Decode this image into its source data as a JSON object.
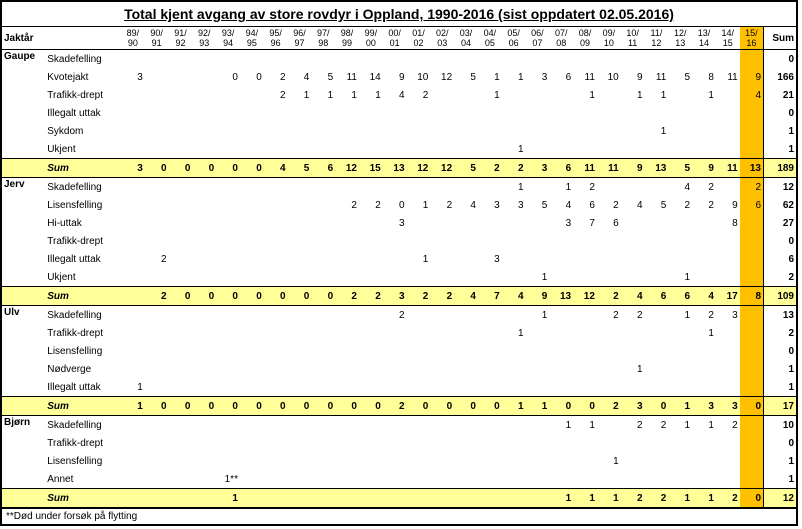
{
  "title": "Total kjent avgang av store rovdyr i Oppland, 1990-2016 (sist oppdatert 02.05.2016)",
  "axis_label": "Jaktår",
  "footnote": "**Død under forsøk på flytting",
  "sum_label": "Sum",
  "years": [
    "89/ 90",
    "90/ 91",
    "91/ 92",
    "92/ 93",
    "93/ 94",
    "94/ 95",
    "95/ 96",
    "96/ 97",
    "97/ 98",
    "98/ 99",
    "99/ 00",
    "00/ 01",
    "01/ 02",
    "02/ 03",
    "03/ 04",
    "04/ 05",
    "05/ 06",
    "06/ 07",
    "07/ 08",
    "08/ 09",
    "09/ 10",
    "10/ 11",
    "11/ 12",
    "12/ 13",
    "13/ 14",
    "14/ 15",
    "15/ 16"
  ],
  "species": [
    {
      "name": "Gaupe",
      "rows": [
        {
          "label": "Skadefelling",
          "vals": [
            "",
            "",
            "",
            "",
            "",
            "",
            "",
            "",
            "",
            "",
            "",
            "",
            "",
            "",
            "",
            "",
            "",
            "",
            "",
            "",
            "",
            "",
            "",
            "",
            "",
            "",
            ""
          ],
          "sum": "0"
        },
        {
          "label": "Kvotejakt",
          "vals": [
            "3",
            "",
            "",
            "",
            "0",
            "0",
            "2",
            "4",
            "5",
            "11",
            "14",
            "9",
            "10",
            "12",
            "5",
            "1",
            "1",
            "3",
            "6",
            "11",
            "10",
            "9",
            "11",
            "5",
            "8",
            "11",
            "9"
          ],
          "sum": "166"
        },
        {
          "label": "Trafikk-drept",
          "vals": [
            "",
            "",
            "",
            "",
            "",
            "",
            "2",
            "1",
            "1",
            "1",
            "1",
            "4",
            "2",
            "",
            "",
            "1",
            "",
            "",
            "",
            "1",
            "",
            "1",
            "1",
            "",
            "1",
            "",
            "4"
          ],
          "sum": "21"
        },
        {
          "label": "Illegalt uttak",
          "vals": [
            "",
            "",
            "",
            "",
            "",
            "",
            "",
            "",
            "",
            "",
            "",
            "",
            "",
            "",
            "",
            "",
            "",
            "",
            "",
            "",
            "",
            "",
            "",
            "",
            "",
            "",
            ""
          ],
          "sum": "0"
        },
        {
          "label": "Sykdom",
          "vals": [
            "",
            "",
            "",
            "",
            "",
            "",
            "",
            "",
            "",
            "",
            "",
            "",
            "",
            "",
            "",
            "",
            "",
            "",
            "",
            "",
            "",
            "",
            "1",
            "",
            "",
            "",
            ""
          ],
          "sum": "1"
        },
        {
          "label": "Ukjent",
          "vals": [
            "",
            "",
            "",
            "",
            "",
            "",
            "",
            "",
            "",
            "",
            "",
            "",
            "",
            "",
            "",
            "",
            "1",
            "",
            "",
            "",
            "",
            "",
            "",
            "",
            "",
            "",
            ""
          ],
          "sum": "1"
        }
      ],
      "sum": {
        "vals": [
          "3",
          "0",
          "0",
          "0",
          "0",
          "0",
          "4",
          "5",
          "6",
          "12",
          "15",
          "13",
          "12",
          "12",
          "5",
          "2",
          "2",
          "3",
          "6",
          "11",
          "11",
          "9",
          "13",
          "5",
          "9",
          "11",
          "13"
        ],
        "sum": "189"
      },
      "highlight": "7"
    },
    {
      "name": "Jerv",
      "rows": [
        {
          "label": "Skadefelling",
          "vals": [
            "",
            "",
            "",
            "",
            "",
            "",
            "",
            "",
            "",
            "",
            "",
            "",
            "",
            "",
            "",
            "",
            "1",
            "",
            "1",
            "2",
            "",
            "",
            "",
            "4",
            "2",
            "",
            "2"
          ],
          "sum": "12"
        },
        {
          "label": "Lisensfelling",
          "vals": [
            "",
            "",
            "",
            "",
            "",
            "",
            "",
            "",
            "",
            "2",
            "2",
            "0",
            "1",
            "2",
            "4",
            "3",
            "3",
            "5",
            "4",
            "6",
            "2",
            "4",
            "5",
            "2",
            "2",
            "9",
            "6"
          ],
          "sum": "62"
        },
        {
          "label": "Hi-uttak",
          "vals": [
            "",
            "",
            "",
            "",
            "",
            "",
            "",
            "",
            "",
            "",
            "",
            "3",
            "",
            "",
            "",
            "",
            "",
            "",
            "3",
            "7",
            "6",
            "",
            "",
            "",
            "",
            "8",
            ""
          ],
          "sum": "27"
        },
        {
          "label": "Trafikk-drept",
          "vals": [
            "",
            "",
            "",
            "",
            "",
            "",
            "",
            "",
            "",
            "",
            "",
            "",
            "",
            "",
            "",
            "",
            "",
            "",
            "",
            "",
            "",
            "",
            "",
            "",
            "",
            "",
            ""
          ],
          "sum": "0"
        },
        {
          "label": "Illegalt uttak",
          "vals": [
            "",
            "2",
            "",
            "",
            "",
            "",
            "",
            "",
            "",
            "",
            "",
            "",
            "1",
            "",
            "",
            "3",
            "",
            "",
            "",
            "",
            "",
            "",
            "",
            "",
            "",
            "",
            ""
          ],
          "sum": "6"
        },
        {
          "label": "Ukjent",
          "vals": [
            "",
            "",
            "",
            "",
            "",
            "",
            "",
            "",
            "",
            "",
            "",
            "",
            "",
            "",
            "",
            "",
            "",
            "1",
            "",
            "",
            "",
            "",
            "",
            "1",
            "",
            "",
            ""
          ],
          "sum": "2"
        }
      ],
      "sum": {
        "vals": [
          "",
          "2",
          "0",
          "0",
          "0",
          "0",
          "0",
          "0",
          "0",
          "2",
          "2",
          "3",
          "2",
          "2",
          "4",
          "7",
          "4",
          "9",
          "13",
          "12",
          "2",
          "4",
          "6",
          "6",
          "4",
          "17",
          "8"
        ],
        "sum": "109"
      },
      "highlight": "8"
    },
    {
      "name": "Ulv",
      "rows": [
        {
          "label": "Skadefelling",
          "vals": [
            "",
            "",
            "",
            "",
            "",
            "",
            "",
            "",
            "",
            "",
            "",
            "2",
            "",
            "",
            "",
            "",
            "",
            "1",
            "",
            "",
            "2",
            "2",
            "",
            "1",
            "2",
            "3",
            ""
          ],
          "sum": "13"
        },
        {
          "label": "Trafikk-drept",
          "vals": [
            "",
            "",
            "",
            "",
            "",
            "",
            "",
            "",
            "",
            "",
            "",
            "",
            "",
            "",
            "",
            "",
            "1",
            "",
            "",
            "",
            "",
            "",
            "",
            "",
            "1",
            "",
            ""
          ],
          "sum": "2"
        },
        {
          "label": "Lisensfelling",
          "vals": [
            "",
            "",
            "",
            "",
            "",
            "",
            "",
            "",
            "",
            "",
            "",
            "",
            "",
            "",
            "",
            "",
            "",
            "",
            "",
            "",
            "",
            "",
            "",
            "",
            "",
            "",
            ""
          ],
          "sum": "0"
        },
        {
          "label": "Nødverge",
          "vals": [
            "",
            "",
            "",
            "",
            "",
            "",
            "",
            "",
            "",
            "",
            "",
            "",
            "",
            "",
            "",
            "",
            "",
            "",
            "",
            "",
            "",
            "1",
            "",
            "",
            "",
            "",
            ""
          ],
          "sum": "1"
        },
        {
          "label": "Illegalt uttak",
          "vals": [
            "1",
            "",
            "",
            "",
            "",
            "",
            "",
            "",
            "",
            "",
            "",
            "",
            "",
            "",
            "",
            "",
            "",
            "",
            "",
            "",
            "",
            "",
            "",
            "",
            "",
            "",
            ""
          ],
          "sum": "1"
        }
      ],
      "sum": {
        "vals": [
          "1",
          "0",
          "0",
          "0",
          "0",
          "0",
          "0",
          "0",
          "0",
          "0",
          "0",
          "2",
          "0",
          "0",
          "0",
          "0",
          "1",
          "1",
          "0",
          "0",
          "2",
          "3",
          "0",
          "1",
          "3",
          "3",
          "0"
        ],
        "sum": "17"
      },
      "highlight": "0"
    },
    {
      "name": "Bjørn",
      "rows": [
        {
          "label": "Skadefelling",
          "vals": [
            "",
            "",
            "",
            "",
            "",
            "",
            "",
            "",
            "",
            "",
            "",
            "",
            "",
            "",
            "",
            "",
            "",
            "",
            "1",
            "1",
            "",
            "2",
            "2",
            "1",
            "1",
            "2",
            ""
          ],
          "sum": "10"
        },
        {
          "label": "Trafikk-drept",
          "vals": [
            "",
            "",
            "",
            "",
            "",
            "",
            "",
            "",
            "",
            "",
            "",
            "",
            "",
            "",
            "",
            "",
            "",
            "",
            "",
            "",
            "",
            "",
            "",
            "",
            "",
            "",
            ""
          ],
          "sum": "0"
        },
        {
          "label": "Lisensfelling",
          "vals": [
            "",
            "",
            "",
            "",
            "",
            "",
            "",
            "",
            "",
            "",
            "",
            "",
            "",
            "",
            "",
            "",
            "",
            "",
            "",
            "",
            "1",
            "",
            "",
            "",
            "",
            "",
            ""
          ],
          "sum": "1"
        },
        {
          "label": "Annet",
          "vals": [
            "",
            "",
            "",
            "",
            "1**",
            "",
            "",
            "",
            "",
            "",
            "",
            "",
            "",
            "",
            "",
            "",
            "",
            "",
            "",
            "",
            "",
            "",
            "",
            "",
            "",
            "",
            ""
          ],
          "sum": "1"
        }
      ],
      "sum": {
        "vals": [
          "",
          "",
          "",
          "",
          "1",
          "",
          "",
          "",
          "",
          "",
          "",
          "",
          "",
          "",
          "",
          "",
          "",
          "",
          "1",
          "1",
          "1",
          "2",
          "2",
          "1",
          "1",
          "2",
          "0"
        ],
        "sum": "12"
      },
      "highlight": "0"
    }
  ]
}
